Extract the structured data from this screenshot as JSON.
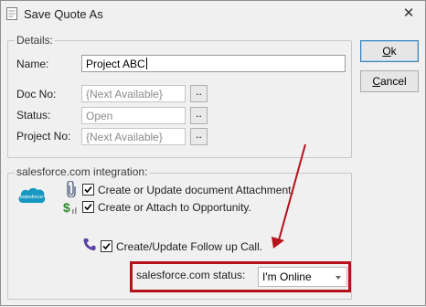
{
  "window": {
    "title": "Save Quote As",
    "close_glyph": "✕"
  },
  "buttons": {
    "ok_label_underlined": "O",
    "ok_label_rest": "k",
    "cancel_label_underlined": "C",
    "cancel_label_rest": "ancel"
  },
  "details": {
    "legend": "Details:",
    "name_label": "Name:",
    "name_value": "Project ABC",
    "docno_label": "Doc No:",
    "docno_value": "{Next Available}",
    "status_label": "Status:",
    "status_value": "Open",
    "projectno_label": "Project No:",
    "projectno_value": "{Next Available}",
    "browse_label": ".."
  },
  "salesforce": {
    "legend": "salesforce.com integration:",
    "logo_text": "salesforce",
    "attachment_label": "Create or Update document Attachment.",
    "attachment_checked": true,
    "opportunity_label": "Create or Attach to Opportunity.",
    "opportunity_checked": true,
    "followup_label": "Create/Update Follow up Call.",
    "followup_checked": true,
    "status_label": "salesforce.com status:",
    "status_value": "I'm Online"
  },
  "colors": {
    "highlight": "#b5121b",
    "salesforce_blue": "#1798c1"
  },
  "icons": [
    "app-icon",
    "close-icon",
    "salesforce-logo-icon",
    "paperclip-icon",
    "opportunity-dollar-icon",
    "phone-icon",
    "dropdown-arrow-icon"
  ]
}
